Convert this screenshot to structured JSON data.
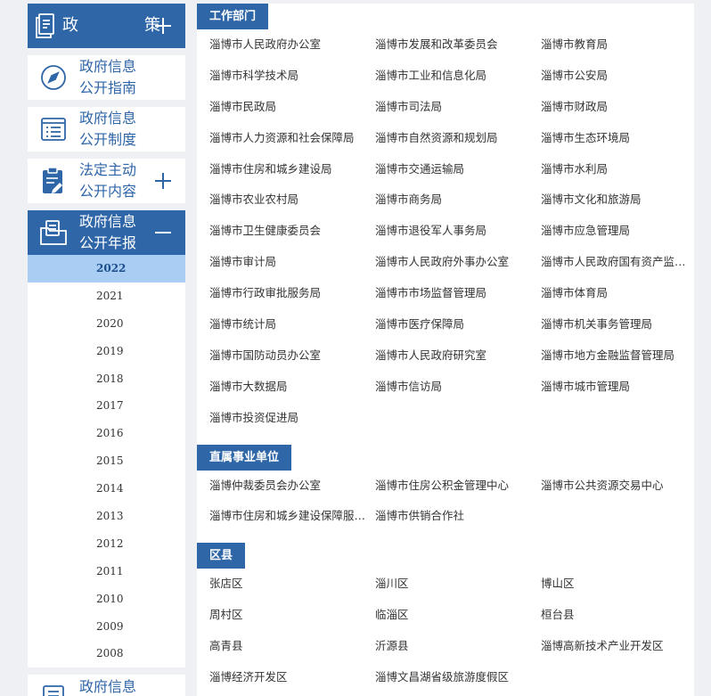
{
  "sidebar": {
    "items": [
      {
        "lines": [
          "政　策"
        ],
        "sign": "+"
      },
      {
        "lines": [
          "政府信息",
          "公开指南"
        ],
        "sign": ""
      },
      {
        "lines": [
          "政府信息",
          "公开制度"
        ],
        "sign": ""
      },
      {
        "lines": [
          "法定主动",
          "公开内容"
        ],
        "sign": "+"
      },
      {
        "lines": [
          "政府信息",
          "公开年报"
        ],
        "sign": "−"
      },
      {
        "lines": [
          "政府信息"
        ],
        "sign": ""
      }
    ],
    "years": [
      "2022",
      "2021",
      "2020",
      "2019",
      "2018",
      "2017",
      "2016",
      "2015",
      "2014",
      "2013",
      "2012",
      "2011",
      "2010",
      "2009",
      "2008"
    ],
    "active_year": "2022"
  },
  "sections": [
    {
      "title": "工作部门",
      "items": [
        "淄博市人民政府办公室",
        "淄博市发展和改革委员会",
        "淄博市教育局",
        "淄博市科学技术局",
        "淄博市工业和信息化局",
        "淄博市公安局",
        "淄博市民政局",
        "淄博市司法局",
        "淄博市财政局",
        "淄博市人力资源和社会保障局",
        "淄博市自然资源和规划局",
        "淄博市生态环境局",
        "淄博市住房和城乡建设局",
        "淄博市交通运输局",
        "淄博市水利局",
        "淄博市农业农村局",
        "淄博市商务局",
        "淄博市文化和旅游局",
        "淄博市卫生健康委员会",
        "淄博市退役军人事务局",
        "淄博市应急管理局",
        "淄博市审计局",
        "淄博市人民政府外事办公室",
        "淄博市人民政府国有资产监督…",
        "淄博市行政审批服务局",
        "淄博市市场监督管理局",
        "淄博市体育局",
        "淄博市统计局",
        "淄博市医疗保障局",
        "淄博市机关事务管理局",
        "淄博市国防动员办公室",
        "淄博市人民政府研究室",
        "淄博市地方金融监督管理局",
        "淄博市大数据局",
        "淄博市信访局",
        "淄博市城市管理局",
        "淄博市投资促进局"
      ]
    },
    {
      "title": "直属事业单位",
      "items": [
        "淄博仲裁委员会办公室",
        "淄博市住房公积金管理中心",
        "淄博市公共资源交易中心",
        "淄博市住房和城乡建设保障服…",
        "淄博市供销合作社"
      ]
    },
    {
      "title": "区县",
      "items": [
        "张店区",
        "淄川区",
        "博山区",
        "周村区",
        "临淄区",
        "桓台县",
        "高青县",
        "沂源县",
        "淄博高新技术产业开发区",
        "淄博经济开发区",
        "淄博文昌湖省级旅游度假区"
      ]
    }
  ],
  "colors": {
    "primary": "#2f66a8",
    "active_year_bg": "#a9cdf3"
  },
  "icons": [
    "document-icon",
    "compass-icon",
    "list-icon",
    "clipboard-edit-icon",
    "folder-icon",
    "document-icon"
  ]
}
